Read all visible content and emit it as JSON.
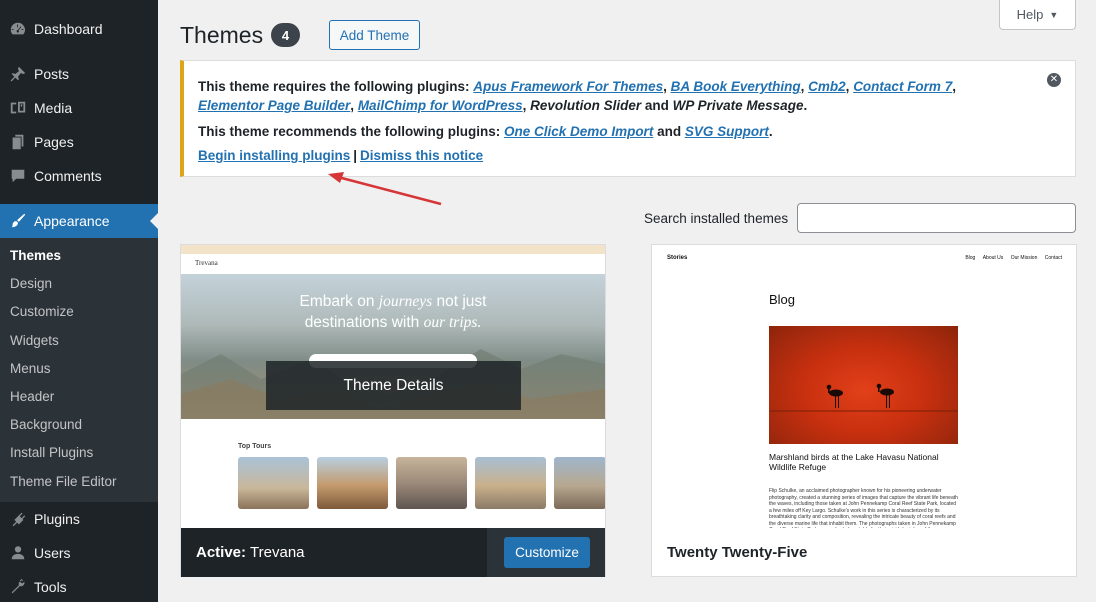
{
  "sidebar": {
    "items_top": [
      {
        "label": "Dashboard",
        "icon": "dashboard-icon"
      },
      {
        "label": "Posts",
        "icon": "pin-icon"
      },
      {
        "label": "Media",
        "icon": "media-icon"
      },
      {
        "label": "Pages",
        "icon": "pages-icon"
      },
      {
        "label": "Comments",
        "icon": "comment-icon"
      }
    ],
    "active": {
      "label": "Appearance",
      "icon": "paintbrush-icon"
    },
    "submenu": [
      "Themes",
      "Design",
      "Customize",
      "Widgets",
      "Menus",
      "Header",
      "Background",
      "Install Plugins",
      "Theme File Editor"
    ],
    "items_bottom": [
      {
        "label": "Plugins",
        "icon": "plugin-icon"
      },
      {
        "label": "Users",
        "icon": "users-icon"
      },
      {
        "label": "Tools",
        "icon": "tools-icon"
      }
    ]
  },
  "header": {
    "title": "Themes",
    "count": "4",
    "add_theme": "Add Theme",
    "help": "Help"
  },
  "notice": {
    "req_prefix": "This theme requires the following plugins: ",
    "req_plugins": [
      "Apus Framework For Themes",
      "BA Book Everything",
      "Cmb2",
      "Contact Form 7",
      "Elementor Page Builder",
      "MailChimp for WordPress"
    ],
    "req_plain_1": "Revolution Slider",
    "req_and": " and ",
    "req_plain_2": "WP Private Message",
    "rec_prefix": "This theme recommends the following plugins: ",
    "rec_plugins": [
      "One Click Demo Import",
      "SVG Support"
    ],
    "begin_installing": "Begin installing plugins",
    "separator": "|",
    "dismiss": "Dismiss this notice"
  },
  "search": {
    "label": "Search installed themes",
    "value": ""
  },
  "themes": [
    {
      "active_label": "Active:",
      "name": "Trevana",
      "details_button": "Theme Details",
      "customize_button": "Customize",
      "preview": {
        "logo": "Trevana",
        "hero_line1_a": "Embark on ",
        "hero_line1_b": "journeys",
        "hero_line1_c": " not just",
        "hero_line2_a": "destinations with ",
        "hero_line2_b": "our trips.",
        "top_tours": "Top Tours"
      }
    },
    {
      "name": "Twenty Twenty-Five",
      "preview": {
        "site_title": "Stories",
        "nav": [
          "Blog",
          "About Us",
          "Our Mission",
          "Contact"
        ],
        "heading": "Blog",
        "caption": "Marshland birds at the Lake Havasu National Wildlife Refuge",
        "paragraph": "Flip Schulke, an acclaimed photographer known for his pioneering underwater photography, created a stunning series of images that capture the vibrant life beneath the waves, including those taken at John Pennekamp Coral Reef State Park, located a few miles off Key Largo. Schulke's work in this series is characterized by its breathtaking clarity and composition, revealing the intricate beauty of coral reefs and the diverse marine life that inhabit them. The photographs taken in John Pennekamp Coral Reef State Park are particularly notable for their vivid depiction of the underwater ecosystem."
      }
    }
  ],
  "colors": {
    "sidebar_bg": "#1d2327",
    "accent": "#2271b1",
    "notice_warning": "#dba617",
    "arrow_annotation": "#d63638"
  }
}
